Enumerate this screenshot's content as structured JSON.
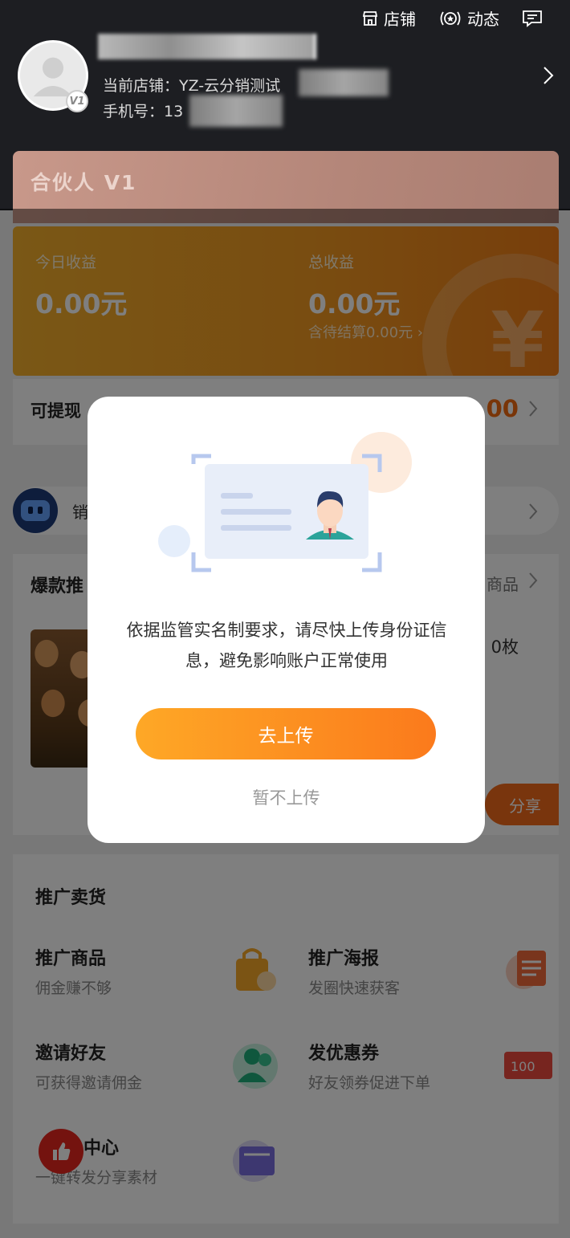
{
  "header": {
    "actions": [
      {
        "label": "店铺",
        "icon": "store-icon"
      },
      {
        "label": "动态",
        "icon": "star-circle-icon"
      },
      {
        "label": "",
        "icon": "message-icon"
      }
    ],
    "avatar_badge": "V1",
    "shop_label": "当前店铺：YZ-云分销测试",
    "phone_label": "手机号：13"
  },
  "partner": {
    "title": "合伙人 V1"
  },
  "income": {
    "today_label": "今日收益",
    "today_value": "0.00元",
    "total_label": "总收益",
    "total_value": "0.00元",
    "pending": "含待结算0.00元 ›"
  },
  "withdraw": {
    "label": "可提现",
    "value": "0.00"
  },
  "bot": {
    "label": "销"
  },
  "hot": {
    "title": "爆款推",
    "more": "商品",
    "product_qty": "0枚",
    "share_label": "分享"
  },
  "promo": {
    "title": "推广卖货",
    "items": [
      {
        "name": "推广商品",
        "desc": "佣金赚不够",
        "icon": "shopping-bag-icon"
      },
      {
        "name": "推广海报",
        "desc": "发圈快速获客",
        "icon": "poster-icon"
      },
      {
        "name": "邀请好友",
        "desc": "可获得邀请佣金",
        "icon": "users-icon"
      },
      {
        "name": "发优惠券",
        "desc": "好友领券促进下单",
        "icon": "coupon-icon"
      },
      {
        "name": "中心",
        "desc": "一键转发分享素材",
        "icon": "material-icon"
      }
    ],
    "coupon_text": "100"
  },
  "modal": {
    "message": "依据监管实名制要求，请尽快上传身份证信息，避免影响账户正常使用",
    "primary_label": "去上传",
    "secondary_label": "暂不上传"
  },
  "colors": {
    "header_bg": "#1d1e22",
    "income_orange": "#f39a22",
    "accent_orange": "#fb7a1c",
    "withdraw_value": "#f36b10",
    "thumb_red": "#e8261f"
  }
}
